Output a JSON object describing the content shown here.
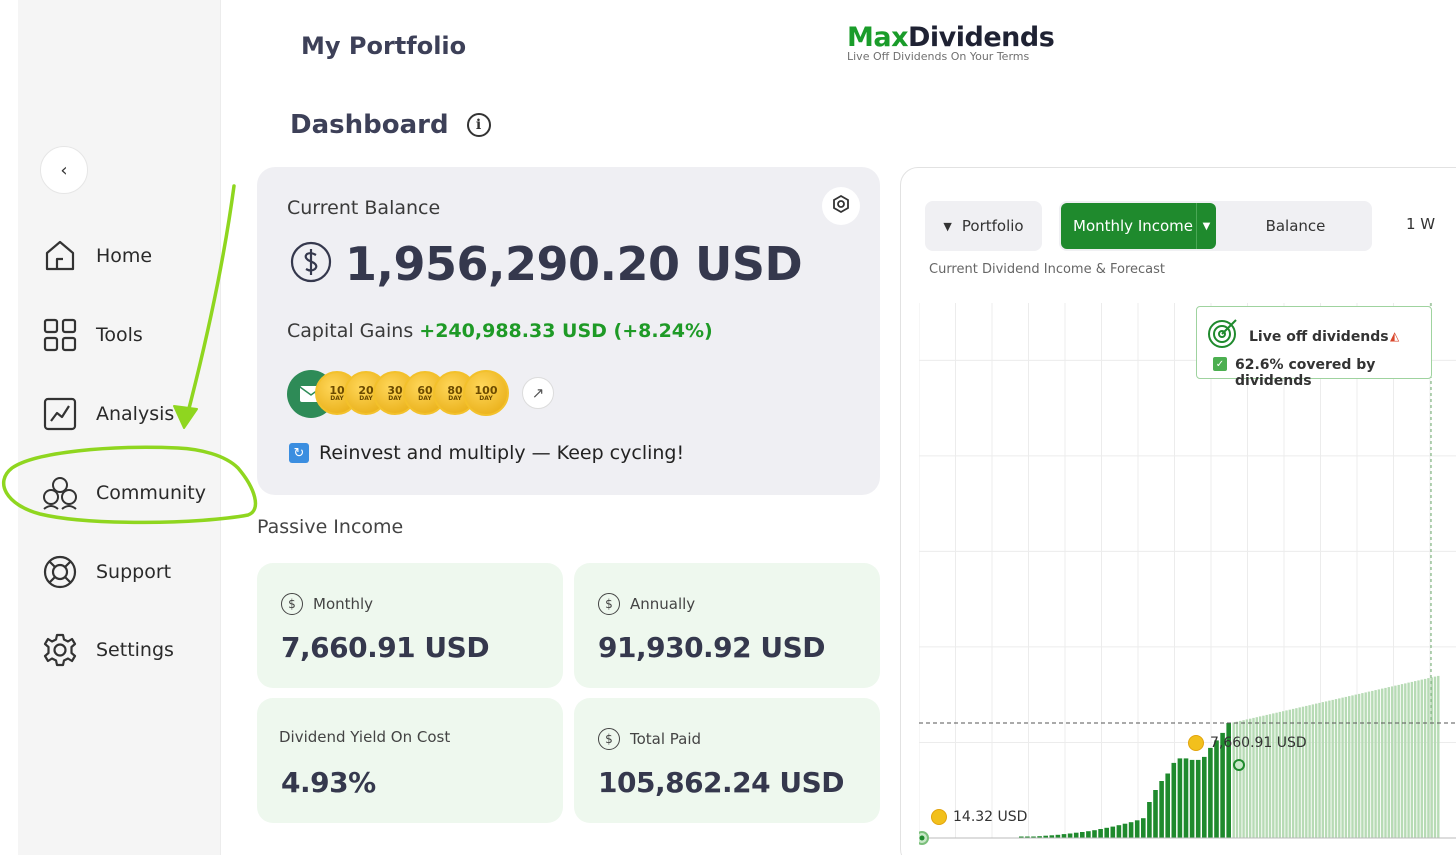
{
  "sidebar": {
    "items": [
      {
        "label": "Home",
        "icon": "home-icon"
      },
      {
        "label": "Tools",
        "icon": "grid-icon"
      },
      {
        "label": "Analysis",
        "icon": "chart-icon"
      },
      {
        "label": "Community",
        "icon": "people-icon"
      },
      {
        "label": "Support",
        "icon": "lifebuoy-icon"
      },
      {
        "label": "Settings",
        "icon": "gear-icon"
      }
    ]
  },
  "header": {
    "title": "My Portfolio",
    "brand_prefix": "Max",
    "brand_suffix": "Dividends",
    "brand_tagline": "Live Off Dividends On Your Terms"
  },
  "dashboard": {
    "title": "Dashboard",
    "info_glyph": "i"
  },
  "balance": {
    "label": "Current Balance",
    "value": "1,956,290.20 USD",
    "gains_label": "Capital Gains",
    "gains_value": "+240,988.33 USD (+8.24%)",
    "badges": [
      {
        "n": "10",
        "d": "DAY"
      },
      {
        "n": "20",
        "d": "DAY"
      },
      {
        "n": "30",
        "d": "DAY"
      },
      {
        "n": "60",
        "d": "DAY"
      },
      {
        "n": "80",
        "d": "DAY"
      },
      {
        "n": "100",
        "d": "DAY"
      }
    ],
    "reinvest_text": "Reinvest and multiply — Keep cycling!"
  },
  "passive": {
    "label": "Passive Income",
    "monthly_label": "Monthly",
    "monthly_value": "7,660.91 USD",
    "annually_label": "Annually",
    "annually_value": "91,930.92 USD",
    "yield_label": "Dividend Yield On Cost",
    "yield_value": "4.93%",
    "total_label": "Total Paid",
    "total_value": "105,862.24 USD"
  },
  "chart_panel": {
    "portfolio_label": "Portfolio",
    "monthly_label": "Monthly Income",
    "balance_label": "Balance",
    "range_label": "1 W",
    "subtitle": "Current Dividend Income & Forecast",
    "goal_title": "Live off dividends",
    "goal_covered": "62.6% covered by dividends",
    "current_label": "7,660.91 USD",
    "start_label": "14.32 USD"
  },
  "chart_data": {
    "type": "bar",
    "series": [
      {
        "values": [
          14.32,
          60,
          90,
          120,
          150,
          180,
          210,
          260,
          300,
          350,
          400,
          450,
          520,
          600,
          680,
          760,
          850,
          950,
          1050,
          1180,
          1320,
          2400,
          3200,
          3800,
          4300,
          5000,
          5300,
          5300,
          5200,
          5200,
          5400,
          6000,
          6500,
          7000,
          7660.91
        ]
      },
      {
        "values": [
          7700,
          7750,
          7800,
          7850,
          7900,
          7950,
          8000,
          8050,
          8100,
          8150,
          8200,
          8250,
          8300,
          8350,
          8400,
          8450,
          8500,
          8550,
          8600,
          8650,
          8700,
          8750,
          8800,
          8850,
          8900,
          8950,
          9000,
          9050,
          9100,
          9150,
          9200,
          9250,
          9300,
          9350,
          9400,
          9450,
          9500,
          9550,
          9600,
          9650,
          9700,
          9750,
          9800,
          9850,
          9900,
          9950,
          10000,
          10050,
          10100,
          10150,
          10200,
          10250,
          10300,
          10350,
          10400,
          10450,
          10500,
          10550,
          10600,
          10650,
          10700,
          10750,
          10800
        ]
      }
    ],
    "ylim": [
      0,
      60000
    ],
    "grid": true,
    "colors": {
      "actual": "#1f8a2d",
      "forecast": "#b7dbb5"
    }
  },
  "colors": {
    "accent": "#1f8a2d",
    "gain": "#1e9a26",
    "annotation": "#8fd61f"
  }
}
